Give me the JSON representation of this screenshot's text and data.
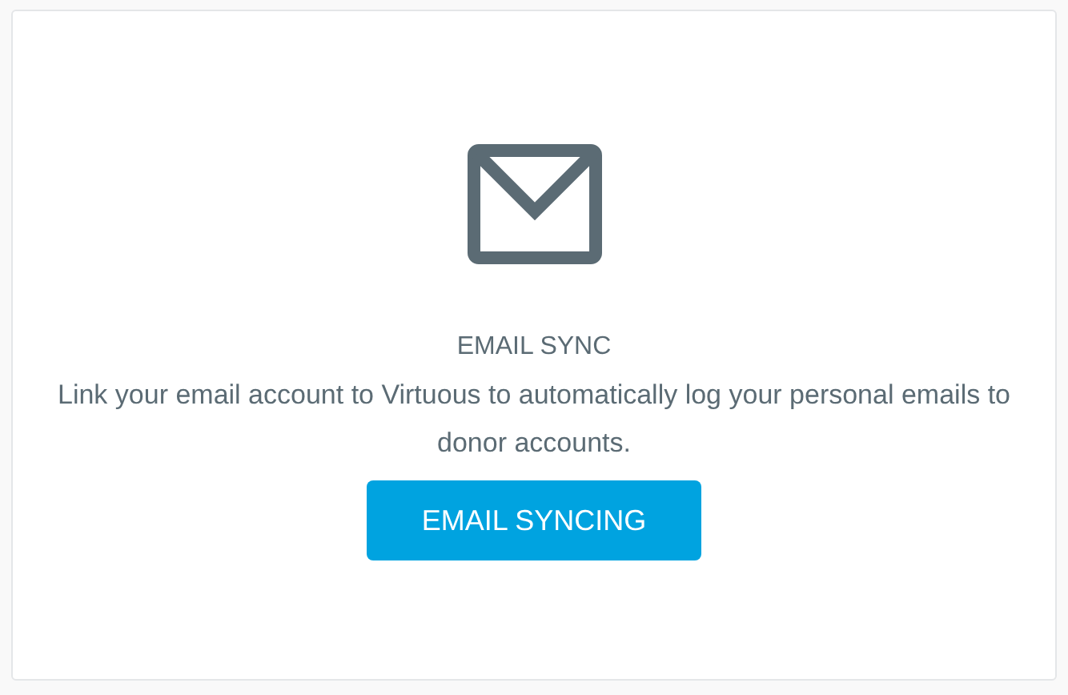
{
  "card": {
    "title": "EMAIL SYNC",
    "description": "Link your email account to Virtuous to automatically log your personal emails to donor accounts.",
    "button": "EMAIL SYNCING"
  }
}
